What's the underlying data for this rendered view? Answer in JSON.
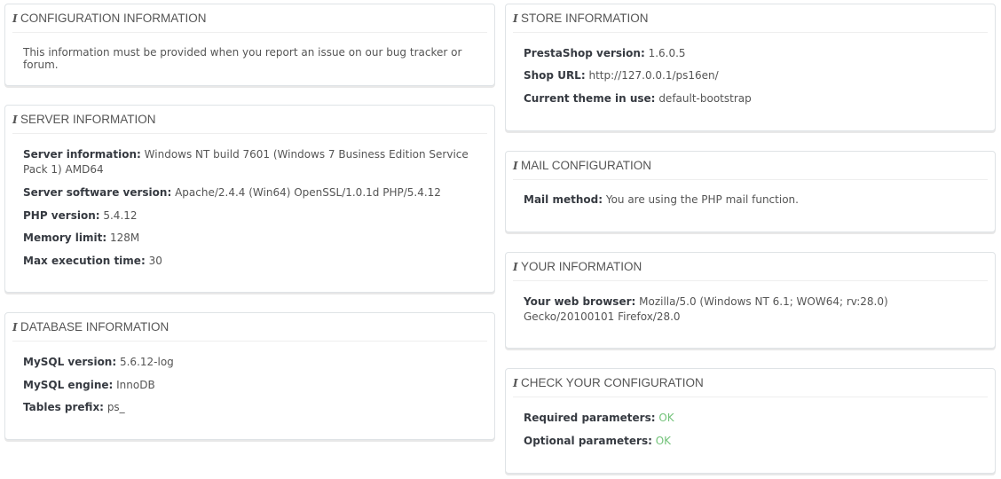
{
  "config": {
    "title": "CONFIGURATION INFORMATION",
    "text": "This information must be provided when you report an issue on our bug tracker or forum."
  },
  "server": {
    "title": "SERVER INFORMATION",
    "rows": [
      {
        "label": "Server information:",
        "value": "Windows NT build 7601 (Windows 7 Business Edition Service Pack 1) AMD64"
      },
      {
        "label": "Server software version:",
        "value": "Apache/2.4.4 (Win64) OpenSSL/1.0.1d PHP/5.4.12"
      },
      {
        "label": "PHP version:",
        "value": "5.4.12"
      },
      {
        "label": "Memory limit:",
        "value": "128M"
      },
      {
        "label": "Max execution time:",
        "value": "30"
      }
    ]
  },
  "database": {
    "title": "DATABASE INFORMATION",
    "rows": [
      {
        "label": "MySQL version:",
        "value": "5.6.12-log"
      },
      {
        "label": "MySQL engine:",
        "value": "InnoDB"
      },
      {
        "label": "Tables prefix:",
        "value": "ps_"
      }
    ]
  },
  "store": {
    "title": "STORE INFORMATION",
    "rows": [
      {
        "label": "PrestaShop version:",
        "value": "1.6.0.5"
      },
      {
        "label": "Shop URL:",
        "value": "http://127.0.0.1/ps16en/"
      },
      {
        "label": "Current theme in use:",
        "value": "default-bootstrap"
      }
    ]
  },
  "mail": {
    "title": "MAIL CONFIGURATION",
    "rows": [
      {
        "label": "Mail method:",
        "value": "You are using the PHP mail function."
      }
    ]
  },
  "your_info": {
    "title": "YOUR INFORMATION",
    "rows": [
      {
        "label": "Your web browser:",
        "value": "Mozilla/5.0 (Windows NT 6.1; WOW64; rv:28.0) Gecko/20100101 Firefox/28.0"
      }
    ]
  },
  "check": {
    "title": "CHECK YOUR CONFIGURATION",
    "rows": [
      {
        "label": "Required parameters:",
        "value": "OK"
      },
      {
        "label": "Optional parameters:",
        "value": "OK"
      }
    ]
  },
  "colors": {
    "ok": "#72c279",
    "label": "#363a41",
    "text": "#555555",
    "border": "#dfe3e6"
  },
  "icons": {
    "panel_heading_icon": "info-icon"
  }
}
